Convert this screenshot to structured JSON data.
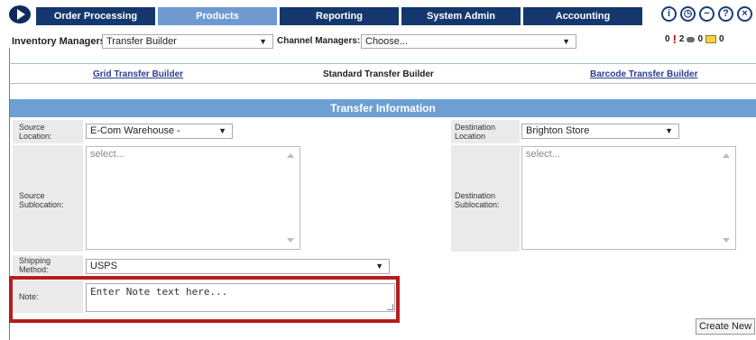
{
  "nav": {
    "tabs": [
      "Order Processing",
      "Products",
      "Reporting",
      "System Admin",
      "Accounting"
    ],
    "active": "Products",
    "icons": [
      "info-icon",
      "history-icon",
      "minus-icon",
      "help-icon",
      "close-icon"
    ]
  },
  "managers": {
    "inventory_label": "Inventory Managers:",
    "inventory_value": "Transfer Builder",
    "channel_label": "Channel Managers:",
    "channel_value": "Choose..."
  },
  "counters": {
    "alerts": "0",
    "messages": "2",
    "mail_prefix": "0",
    "mail": "0"
  },
  "sublinks": {
    "grid": "Grid Transfer Builder",
    "standard": "Standard Transfer Builder",
    "barcode": "Barcode Transfer Builder"
  },
  "section_title": "Transfer Information",
  "form": {
    "source_location_label": "Source Location:",
    "source_location_value": "E-Com Warehouse -",
    "destination_location_label": "Destination Location",
    "destination_location_value": "Brighton Store",
    "source_sublocation_label": "Source Sublocation:",
    "source_sublocation_placeholder": "select...",
    "destination_sublocation_label": "Destination Sublocation:",
    "destination_sublocation_placeholder": "select...",
    "shipping_method_label": "Shipping Method:",
    "shipping_method_value": "USPS",
    "note_label": "Note:",
    "note_placeholder": "Enter Note text here..."
  },
  "buttons": {
    "create_new": "Create New"
  },
  "colors": {
    "nav": "#14386e",
    "nav_active": "#6e9ad1",
    "header": "#6d9fd3",
    "highlight": "#b51d1d"
  }
}
